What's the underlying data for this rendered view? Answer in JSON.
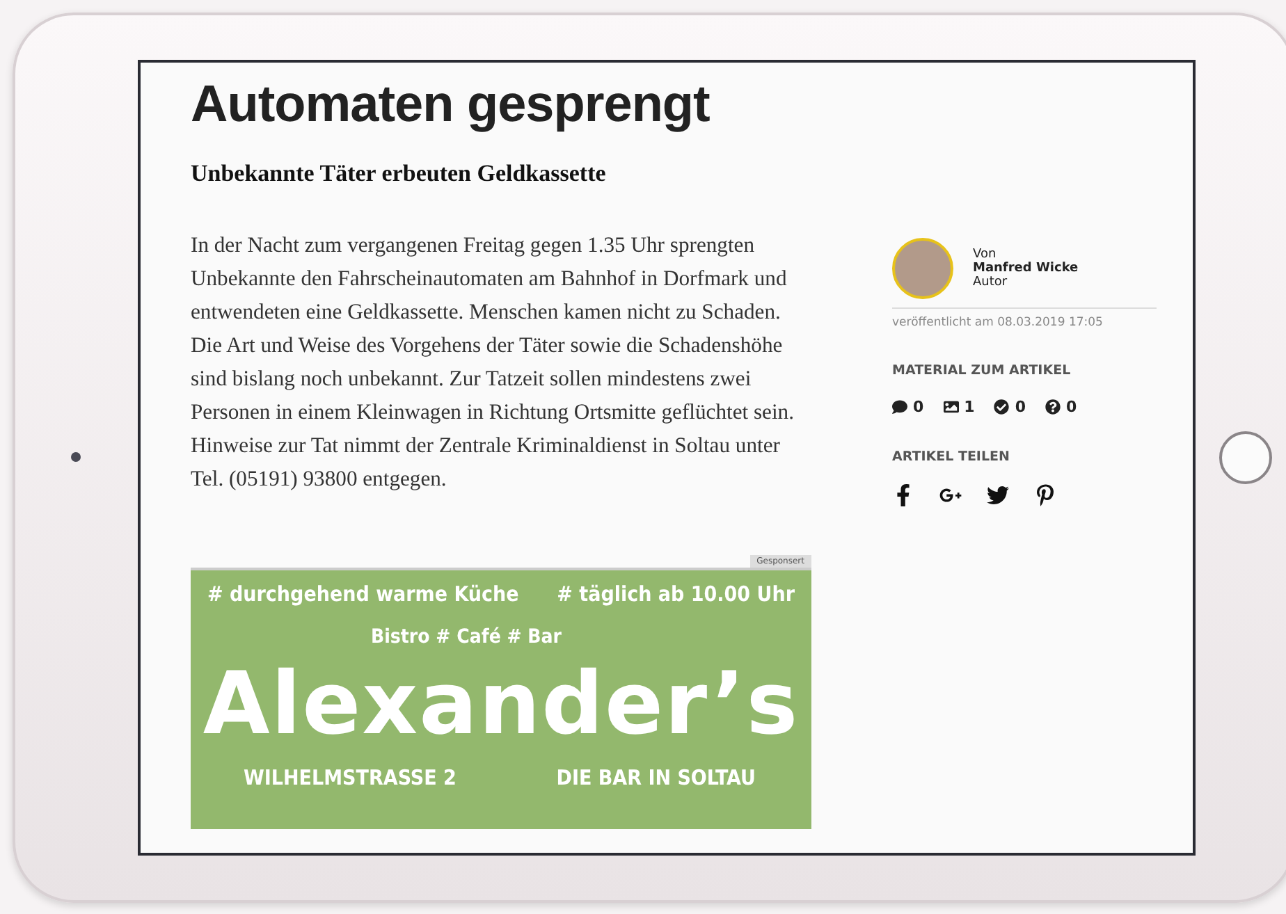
{
  "article": {
    "title": "Automaten gesprengt",
    "subtitle": "Unbekannte Täter erbeuten Geldkassette",
    "body": "In der Nacht zum vergangenen Freitag gegen 1.35 Uhr sprengten Unbekannte den Fahrscheinautomaten am Bahnhof in Dorfmark und entwendeten eine Geldkassette. Menschen kamen nicht zu Schaden. Die Art und Weise des Vorgehens der Täter sowie die Schadenshöhe sind bislang noch unbekannt. Zur Tatzeit sollen mindestens zwei Personen in einem Kleinwagen in Richtung Ortsmitte geflüchtet sein. Hinweise zur Tat nimmt der Zentrale Kriminaldienst in Soltau unter Tel. (05191) 93800 entgegen."
  },
  "ad": {
    "label": "Gesponsert",
    "tagline_left": "# durchgehend warme Küche",
    "tagline_right": "# täglich ab 10.00 Uhr",
    "subtitle": "Bistro # Café # Bar",
    "name": "Alexander’s",
    "address": "WILHELMSTRASSE 2",
    "slogan": "DIE BAR IN SOLTAU"
  },
  "sidebar": {
    "author": {
      "prefix": "Von",
      "name": "Manfred Wicke",
      "role": "Autor"
    },
    "published": "veröffentlicht am 08.03.2019 17:05",
    "material_heading": "MATERIAL ZUM ARTIKEL",
    "materials": [
      {
        "count": "0"
      },
      {
        "count": "1"
      },
      {
        "count": "0"
      },
      {
        "count": "0"
      }
    ],
    "share_heading": "ARTIKEL TEILEN"
  }
}
